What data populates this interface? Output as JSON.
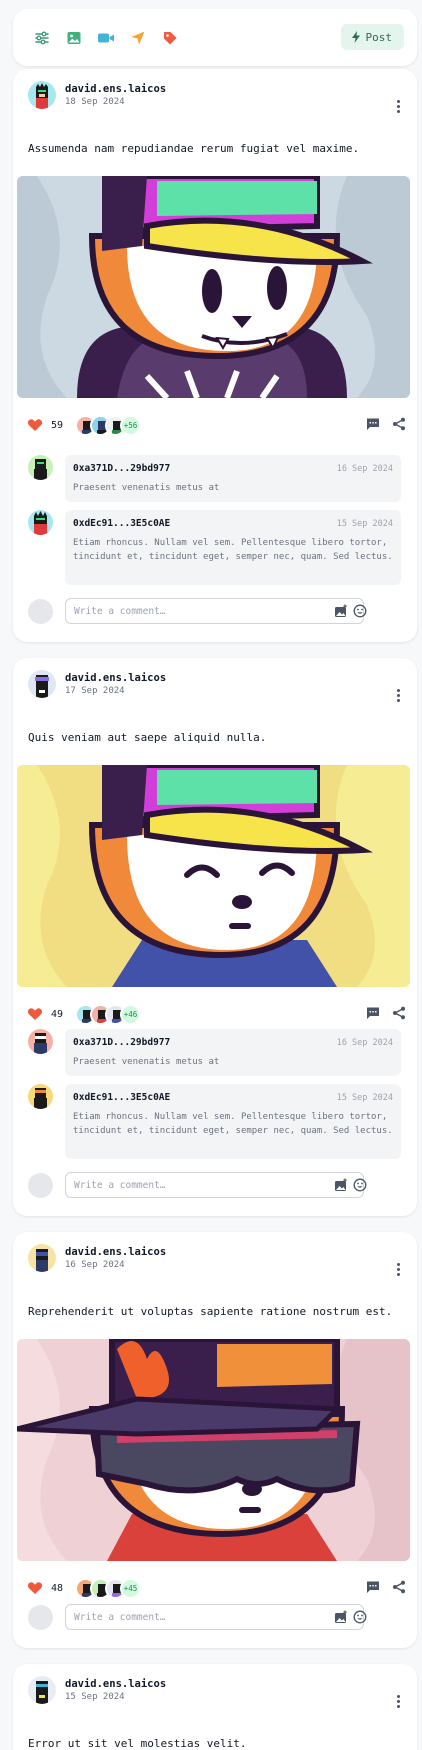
{
  "toolbar": {
    "icons": [
      "sliders-icon",
      "image-icon",
      "video-icon",
      "location-icon",
      "tag-icon"
    ],
    "post_label": "Post"
  },
  "colors": {
    "accent_green": "#e3f5ec",
    "like_red": "#ef5a3c"
  },
  "composer_placeholder": "Write a comment…",
  "posts": [
    {
      "author": "david.ens.laicos",
      "date": "18 Sep 2024",
      "text": "Assumenda nam repudiandae rerum fugiat vel maxime.",
      "likes": "59",
      "more_likes": "+56",
      "image_bg": "#cdd9e2",
      "comments": [
        {
          "address": "0xa371D...29bd977",
          "date": "16 Sep 2024",
          "text": "Praesent venenatis metus at"
        },
        {
          "address": "0xdEc91...3E5c0AE",
          "date": "15 Sep 2024",
          "text": "Etiam rhoncus. Nullam vel sem. Pellentesque libero tortor, tincidunt et, tincidunt eget, semper nec, quam. Sed lectus."
        }
      ]
    },
    {
      "author": "david.ens.laicos",
      "date": "17 Sep 2024",
      "text": "Quis veniam aut saepe aliquid nulla.",
      "likes": "49",
      "more_likes": "+46",
      "image_bg": "#f1dd82",
      "comments": [
        {
          "address": "0xa371D...29bd977",
          "date": "16 Sep 2024",
          "text": "Praesent venenatis metus at"
        },
        {
          "address": "0xdEc91...3E5c0AE",
          "date": "15 Sep 2024",
          "text": "Etiam rhoncus. Nullam vel sem. Pellentesque libero tortor, tincidunt et, tincidunt eget, semper nec, quam. Sed lectus."
        }
      ]
    },
    {
      "author": "david.ens.laicos",
      "date": "16 Sep 2024",
      "text": "Reprehenderit ut voluptas sapiente ratione nostrum est.",
      "likes": "48",
      "more_likes": "+45",
      "image_bg": "#efd0d4",
      "comments": []
    },
    {
      "author": "david.ens.laicos",
      "date": "15 Sep 2024",
      "text": "Error ut sit vel molestias velit."
    }
  ]
}
